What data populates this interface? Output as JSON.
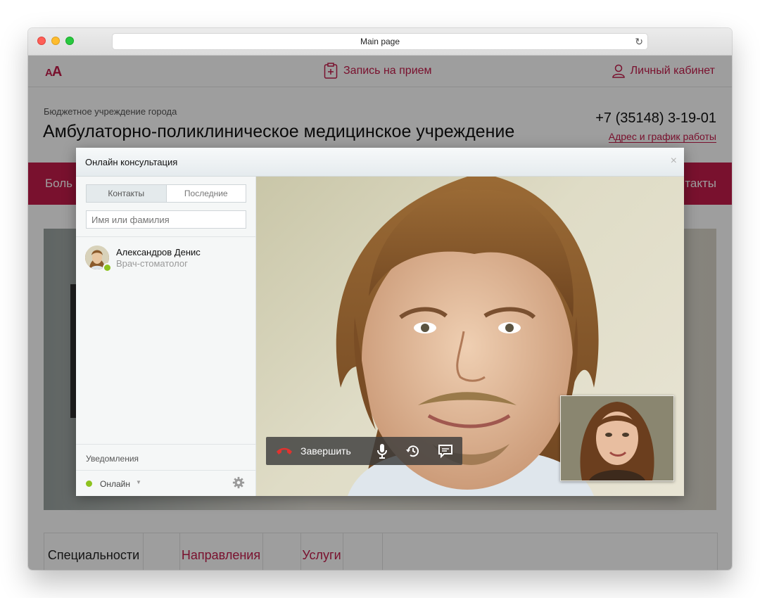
{
  "browser": {
    "url_title": "Main page"
  },
  "header": {
    "logo": "AA",
    "appointment_label": "Запись на прием",
    "cabinet_label": "Личный кабинет",
    "org_subtitle": "Бюджетное учреждение города",
    "org_title": "Амбулаторно-поликлиническое медицинское учреждение",
    "phone": "+7 (35148) 3-19-01",
    "address_link": "Адрес и график работы"
  },
  "redbar": {
    "left_text": "Боль",
    "right_text": "такты"
  },
  "tabs": [
    {
      "label": "Специальности"
    },
    {
      "label": "Направления"
    },
    {
      "label": "Услуги"
    }
  ],
  "modal": {
    "title": "Онлайн консультация",
    "close": "×",
    "segments": [
      "Контакты",
      "Последние"
    ],
    "search_placeholder": "Имя или фамилия",
    "contacts": [
      {
        "name": "Александров Денис",
        "role": "Врач-стоматолог"
      }
    ],
    "notifications_label": "Уведомления",
    "status_label": "Онлайн",
    "call": {
      "end_label": "Завершить"
    }
  },
  "colors": {
    "accent": "#c41c4b",
    "online": "#8dc21f",
    "end_call": "#e2322f"
  }
}
